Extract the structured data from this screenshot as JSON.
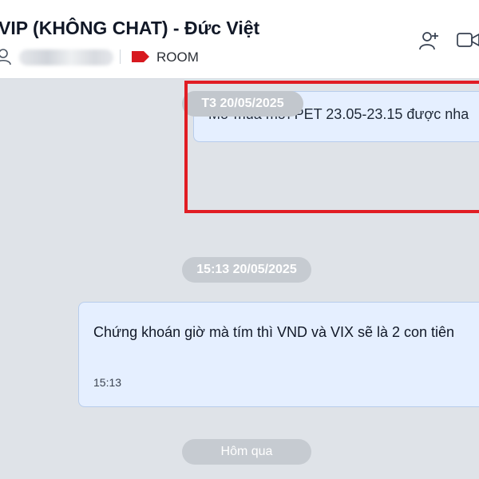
{
  "header": {
    "title": "VIP (KHÔNG CHAT) - Đức Việt",
    "tag_label": "ROOM",
    "icons": {
      "members": "user-icon",
      "tag": "tag-icon",
      "add_member": "add-member-icon",
      "video": "video-call-icon"
    }
  },
  "chat": {
    "date_pill_1": "T3 20/05/2025",
    "message_1": {
      "text": "Mở mua mới PET 23.05-23.15 được nha"
    },
    "date_pill_2": "15:13 20/05/2025",
    "message_2": {
      "text": "Chứng khoán giờ mà tím thì VND và VIX sẽ là 2 con tiên",
      "time": "15:13"
    },
    "date_pill_3": "Hôm qua"
  },
  "colors": {
    "background": "#dfe3e8",
    "bubble": "#e5efff",
    "bubble_border": "#b8cdec",
    "pill": "#c6cbd1",
    "tag": "#d7191f",
    "highlight": "#e11d24"
  }
}
